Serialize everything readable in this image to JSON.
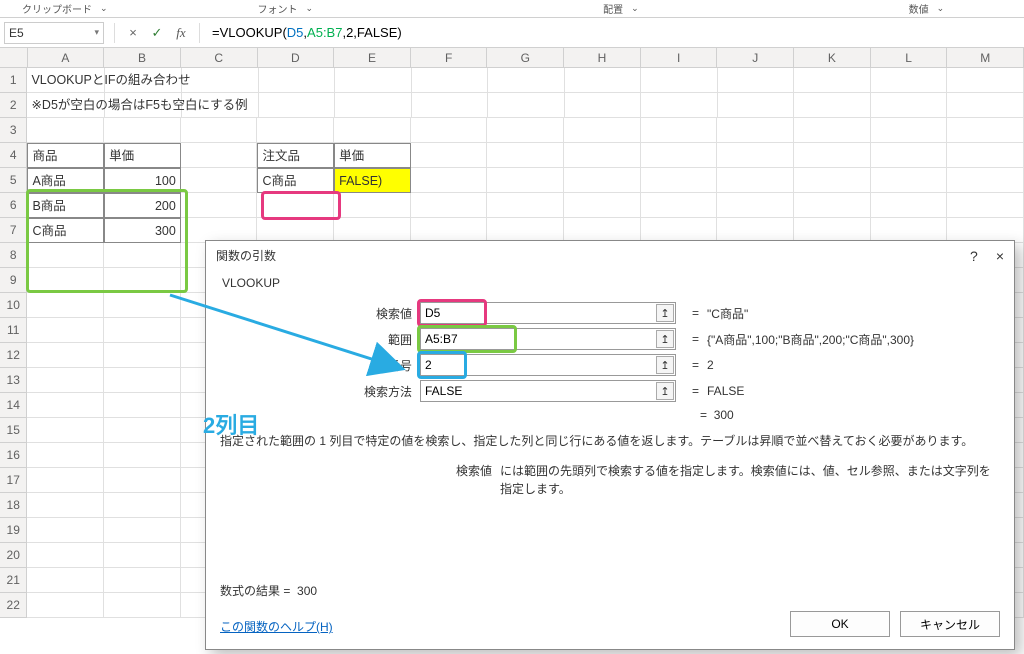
{
  "ribbon": {
    "group_clipboard": "クリップボード",
    "group_font": "フォント",
    "group_align": "配置",
    "group_number": "数値"
  },
  "formula_bar": {
    "name_box": "E5",
    "cancel_tip": "×",
    "enter_tip": "✓",
    "fx_tip": "fx",
    "formula_prefix": "=VLOOKUP",
    "formula_open": "(",
    "formula_arg1": "D5",
    "formula_sep1": ",",
    "formula_arg2": "A5:B7",
    "formula_rest": ",2,FALSE)"
  },
  "columns": [
    "A",
    "B",
    "C",
    "D",
    "E",
    "F",
    "G",
    "H",
    "I",
    "J",
    "K",
    "L",
    "M"
  ],
  "rows": [
    "1",
    "2",
    "3",
    "4",
    "5",
    "6",
    "7",
    "8",
    "9",
    "10",
    "11",
    "12",
    "13",
    "14",
    "15",
    "16",
    "17",
    "18",
    "19",
    "20",
    "21",
    "22"
  ],
  "cells": {
    "A1": "VLOOKUPとIFの組み合わせ",
    "A2": "※D5が空白の場合はF5も空白にする例",
    "A4": "商品",
    "B4": "単価",
    "A5": "A商品",
    "B5": "100",
    "A6": "B商品",
    "B6": "200",
    "A7": "C商品",
    "B7": "300",
    "D4": "注文品",
    "E4": "単価",
    "D5": "C商品",
    "E5": "FALSE)"
  },
  "dialog": {
    "title": "関数の引数",
    "help_symbol": "?",
    "close_symbol": "×",
    "function_name": "VLOOKUP",
    "rows": {
      "lookup": {
        "label": "検索値",
        "value": "D5",
        "result": "\"C商品\""
      },
      "range": {
        "label": "範囲",
        "value": "A5:B7",
        "result": "{\"A商品\",100;\"B商品\",200;\"C商品\",300}"
      },
      "col": {
        "label": "列番号",
        "value": "2",
        "result": "2"
      },
      "type": {
        "label": "検索方法",
        "value": "FALSE",
        "result": "FALSE"
      }
    },
    "final_result_eq": "=",
    "final_result_val": "300",
    "desc1": "指定された範囲の 1 列目で特定の値を検索し、指定した列と同じ行にある値を返します。テーブルは昇順で並べ替えておく必要があります。",
    "desc2_label": "検索値",
    "desc2_text": "には範囲の先頭列で検索する値を指定します。検索値には、値、セル参照、または文字列を指定します。",
    "formula_result_label": "数式の結果 =",
    "formula_result_value": "300",
    "help_link": "この関数のヘルプ(H)",
    "ok": "OK",
    "cancel": "キャンセル",
    "ref_icon": "↥"
  },
  "annotation": {
    "label": "2列目"
  }
}
